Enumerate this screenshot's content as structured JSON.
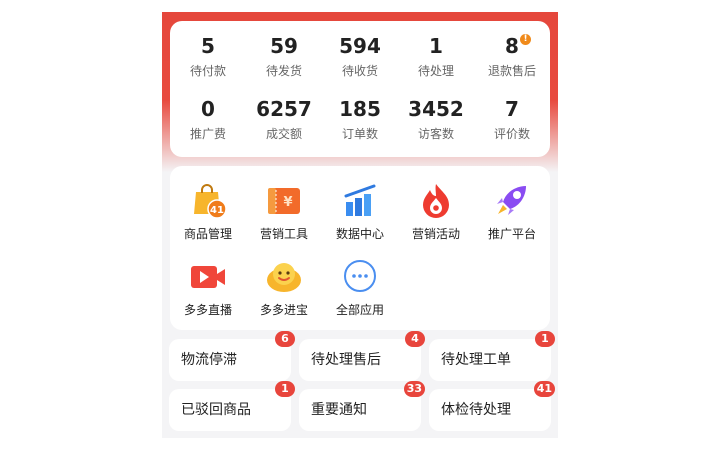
{
  "stats": [
    {
      "value": "5",
      "label": "待付款"
    },
    {
      "value": "59",
      "label": "待发货"
    },
    {
      "value": "594",
      "label": "待收货"
    },
    {
      "value": "1",
      "label": "待处理"
    },
    {
      "value": "8",
      "label": "退款售后",
      "badge": "!"
    },
    {
      "value": "0",
      "label": "推广费"
    },
    {
      "value": "6257",
      "label": "成交额"
    },
    {
      "value": "185",
      "label": "订单数"
    },
    {
      "value": "3452",
      "label": "访客数"
    },
    {
      "value": "7",
      "label": "评价数"
    }
  ],
  "apps": [
    {
      "label": "商品管理",
      "icon": "shopping-bag-icon",
      "badge": "41"
    },
    {
      "label": "营销工具",
      "icon": "coupon-icon"
    },
    {
      "label": "数据中心",
      "icon": "bar-chart-icon"
    },
    {
      "label": "营销活动",
      "icon": "flame-icon"
    },
    {
      "label": "推广平台",
      "icon": "rocket-icon"
    },
    {
      "label": "多多直播",
      "icon": "video-camera-icon"
    },
    {
      "label": "多多进宝",
      "icon": "mascot-icon"
    },
    {
      "label": "全部应用",
      "icon": "more-icon"
    }
  ],
  "tiles": [
    {
      "label": "物流停滞",
      "count": "6"
    },
    {
      "label": "待处理售后",
      "count": "4"
    },
    {
      "label": "待处理工单",
      "count": "1"
    },
    {
      "label": "已驳回商品",
      "count": "1"
    },
    {
      "label": "重要通知",
      "count": "33"
    },
    {
      "label": "体检待处理",
      "count": "41"
    }
  ],
  "colors": {
    "accent": "#e5473c",
    "badge_orange": "#f08a1b",
    "badge_red": "#e8453c"
  }
}
